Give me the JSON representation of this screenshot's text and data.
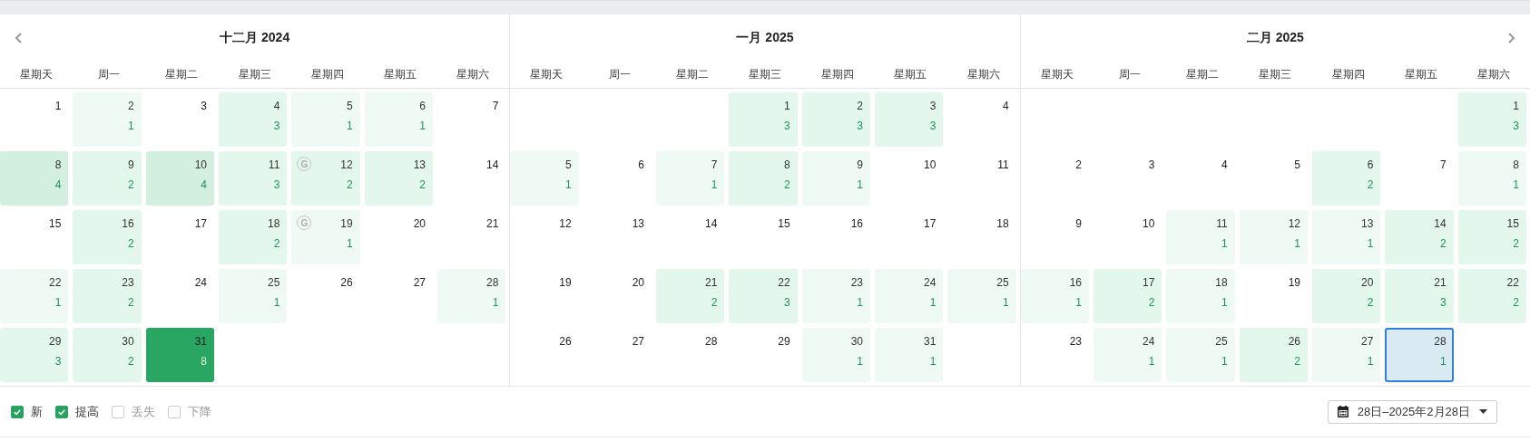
{
  "nav": {
    "previous": true,
    "next": true
  },
  "months": [
    {
      "title": "十二月 2024",
      "weekdays": [
        "星期天",
        "周一",
        "星期二",
        "星期三",
        "星期四",
        "星期五",
        "星期六"
      ],
      "weeks": [
        [
          {
            "kind": "day",
            "day": "1"
          },
          {
            "kind": "day",
            "day": "2",
            "count": "1",
            "color": "#f0faf5"
          },
          {
            "kind": "day",
            "day": "3"
          },
          {
            "kind": "day",
            "day": "4",
            "count": "3",
            "color": "#e3f7ec"
          },
          {
            "kind": "day",
            "day": "5",
            "count": "1",
            "color": "#f0faf5"
          },
          {
            "kind": "day",
            "day": "6",
            "count": "1",
            "color": "#f0faf5"
          },
          {
            "kind": "day",
            "day": "7"
          }
        ],
        [
          {
            "kind": "day",
            "day": "8",
            "count": "4",
            "color": "#d3efe0"
          },
          {
            "kind": "day",
            "day": "9",
            "count": "2",
            "color": "#e3f7ec"
          },
          {
            "kind": "day",
            "day": "10",
            "count": "4",
            "color": "#d3efe0"
          },
          {
            "kind": "day",
            "day": "11",
            "count": "3",
            "color": "#e3f7ec"
          },
          {
            "kind": "day",
            "day": "12",
            "count": "2",
            "color": "#e3f7ec",
            "badge": "G"
          },
          {
            "kind": "day",
            "day": "13",
            "count": "2",
            "color": "#e3f7ec"
          },
          {
            "kind": "day",
            "day": "14"
          }
        ],
        [
          {
            "kind": "day",
            "day": "15"
          },
          {
            "kind": "day",
            "day": "16",
            "count": "2",
            "color": "#e3f7ec"
          },
          {
            "kind": "day",
            "day": "17"
          },
          {
            "kind": "day",
            "day": "18",
            "count": "2",
            "color": "#e3f7ec"
          },
          {
            "kind": "day",
            "day": "19",
            "count": "1",
            "color": "#f0faf5",
            "badge": "G"
          },
          {
            "kind": "day",
            "day": "20"
          },
          {
            "kind": "day",
            "day": "21"
          }
        ],
        [
          {
            "kind": "day",
            "day": "22",
            "count": "1",
            "color": "#f0faf5"
          },
          {
            "kind": "day",
            "day": "23",
            "count": "2",
            "color": "#e3f7ec"
          },
          {
            "kind": "day",
            "day": "24"
          },
          {
            "kind": "day",
            "day": "25",
            "count": "1",
            "color": "#f0faf5"
          },
          {
            "kind": "day",
            "day": "26"
          },
          {
            "kind": "day",
            "day": "27"
          },
          {
            "kind": "day",
            "day": "28",
            "count": "1",
            "color": "#f0faf5"
          }
        ],
        [
          {
            "kind": "day",
            "day": "29",
            "count": "3",
            "color": "#e3f7ec"
          },
          {
            "kind": "day",
            "day": "30",
            "count": "2",
            "color": "#e3f7ec"
          },
          {
            "kind": "day",
            "day": "31",
            "count": "8",
            "color": "#28a662"
          },
          {
            "kind": "blank"
          },
          {
            "kind": "blank"
          },
          {
            "kind": "blank"
          },
          {
            "kind": "blank"
          }
        ]
      ]
    },
    {
      "title": "一月 2025",
      "weekdays": [
        "星期天",
        "周一",
        "星期二",
        "星期三",
        "星期四",
        "星期五",
        "星期六"
      ],
      "weeks": [
        [
          {
            "kind": "blank"
          },
          {
            "kind": "blank"
          },
          {
            "kind": "blank"
          },
          {
            "kind": "day",
            "day": "1",
            "count": "3",
            "color": "#e3f7ec"
          },
          {
            "kind": "day",
            "day": "2",
            "count": "3",
            "color": "#e3f7ec"
          },
          {
            "kind": "day",
            "day": "3",
            "count": "3",
            "color": "#e3f7ec"
          },
          {
            "kind": "day",
            "day": "4"
          }
        ],
        [
          {
            "kind": "day",
            "day": "5",
            "count": "1",
            "color": "#f0faf5"
          },
          {
            "kind": "day",
            "day": "6"
          },
          {
            "kind": "day",
            "day": "7",
            "count": "1",
            "color": "#f0faf5"
          },
          {
            "kind": "day",
            "day": "8",
            "count": "2",
            "color": "#e3f7ec"
          },
          {
            "kind": "day",
            "day": "9",
            "count": "1",
            "color": "#f0faf5"
          },
          {
            "kind": "day",
            "day": "10"
          },
          {
            "kind": "day",
            "day": "11"
          }
        ],
        [
          {
            "kind": "day",
            "day": "12"
          },
          {
            "kind": "day",
            "day": "13"
          },
          {
            "kind": "day",
            "day": "14"
          },
          {
            "kind": "day",
            "day": "15"
          },
          {
            "kind": "day",
            "day": "16"
          },
          {
            "kind": "day",
            "day": "17"
          },
          {
            "kind": "day",
            "day": "18"
          }
        ],
        [
          {
            "kind": "day",
            "day": "19"
          },
          {
            "kind": "day",
            "day": "20"
          },
          {
            "kind": "day",
            "day": "21",
            "count": "2",
            "color": "#e3f7ec"
          },
          {
            "kind": "day",
            "day": "22",
            "count": "3",
            "color": "#e3f7ec"
          },
          {
            "kind": "day",
            "day": "23",
            "count": "1",
            "color": "#f0faf5"
          },
          {
            "kind": "day",
            "day": "24",
            "count": "1",
            "color": "#f0faf5"
          },
          {
            "kind": "day",
            "day": "25",
            "count": "1",
            "color": "#f0faf5"
          }
        ],
        [
          {
            "kind": "day",
            "day": "26"
          },
          {
            "kind": "day",
            "day": "27"
          },
          {
            "kind": "day",
            "day": "28"
          },
          {
            "kind": "day",
            "day": "29"
          },
          {
            "kind": "day",
            "day": "30",
            "count": "1",
            "color": "#f0faf5"
          },
          {
            "kind": "day",
            "day": "31",
            "count": "1",
            "color": "#f0faf5"
          },
          {
            "kind": "blank"
          }
        ]
      ]
    },
    {
      "title": "二月 2025",
      "weekdays": [
        "星期天",
        "周一",
        "星期二",
        "星期三",
        "星期四",
        "星期五",
        "星期六"
      ],
      "weeks": [
        [
          {
            "kind": "blank"
          },
          {
            "kind": "blank"
          },
          {
            "kind": "blank"
          },
          {
            "kind": "blank"
          },
          {
            "kind": "blank"
          },
          {
            "kind": "blank"
          },
          {
            "kind": "day",
            "day": "1",
            "count": "3",
            "color": "#e3f7ec"
          }
        ],
        [
          {
            "kind": "day",
            "day": "2"
          },
          {
            "kind": "day",
            "day": "3"
          },
          {
            "kind": "day",
            "day": "4"
          },
          {
            "kind": "day",
            "day": "5"
          },
          {
            "kind": "day",
            "day": "6",
            "count": "2",
            "color": "#e3f7ec"
          },
          {
            "kind": "day",
            "day": "7"
          },
          {
            "kind": "day",
            "day": "8",
            "count": "1",
            "color": "#f0faf5"
          }
        ],
        [
          {
            "kind": "day",
            "day": "9"
          },
          {
            "kind": "day",
            "day": "10"
          },
          {
            "kind": "day",
            "day": "11",
            "count": "1",
            "color": "#f0faf5"
          },
          {
            "kind": "day",
            "day": "12",
            "count": "1",
            "color": "#f0faf5"
          },
          {
            "kind": "day",
            "day": "13",
            "count": "1",
            "color": "#f0faf5"
          },
          {
            "kind": "day",
            "day": "14",
            "count": "2",
            "color": "#e3f7ec"
          },
          {
            "kind": "day",
            "day": "15",
            "count": "2",
            "color": "#e3f7ec"
          }
        ],
        [
          {
            "kind": "day",
            "day": "16",
            "count": "1",
            "color": "#f0faf5"
          },
          {
            "kind": "day",
            "day": "17",
            "count": "2",
            "color": "#e3f7ec"
          },
          {
            "kind": "day",
            "day": "18",
            "count": "1",
            "color": "#f0faf5"
          },
          {
            "kind": "day",
            "day": "19"
          },
          {
            "kind": "day",
            "day": "20",
            "count": "2",
            "color": "#e3f7ec"
          },
          {
            "kind": "day",
            "day": "21",
            "count": "3",
            "color": "#e3f7ec"
          },
          {
            "kind": "day",
            "day": "22",
            "count": "2",
            "color": "#e3f7ec"
          }
        ],
        [
          {
            "kind": "day",
            "day": "23"
          },
          {
            "kind": "day",
            "day": "24",
            "count": "1",
            "color": "#f0faf5"
          },
          {
            "kind": "day",
            "day": "25",
            "count": "1",
            "color": "#f0faf5"
          },
          {
            "kind": "day",
            "day": "26",
            "count": "2",
            "color": "#e3f7ec"
          },
          {
            "kind": "day",
            "day": "27",
            "count": "1",
            "color": "#f0faf5"
          },
          {
            "kind": "day",
            "day": "28",
            "count": "1",
            "color": "#d9eaf2",
            "selected": true
          },
          {
            "kind": "blank"
          }
        ]
      ]
    }
  ],
  "filters": [
    {
      "label": "新",
      "checked": true
    },
    {
      "label": "提高",
      "checked": true
    },
    {
      "label": "丢失",
      "checked": false
    },
    {
      "label": "下降",
      "checked": false
    }
  ],
  "date_range": {
    "label": "28日–2025年2月28日"
  }
}
